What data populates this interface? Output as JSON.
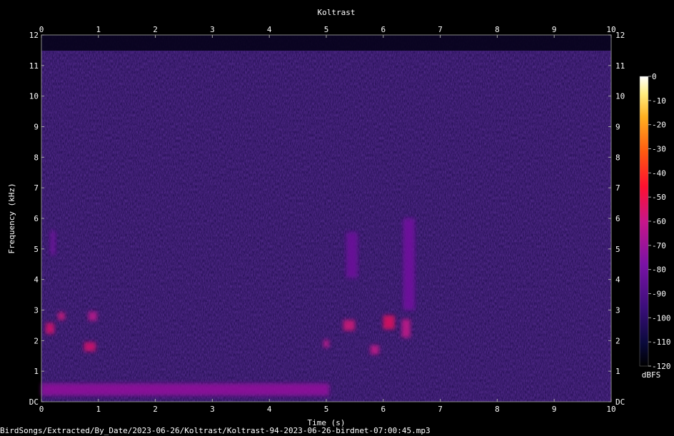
{
  "chart_data": {
    "type": "heatmap",
    "title": "Koltrast",
    "xlabel": "Time (s)",
    "ylabel": "Frequency (kHz)",
    "xlim": [
      0,
      10
    ],
    "ylim": [
      0,
      12
    ],
    "x_ticks": [
      "0",
      "1",
      "2",
      "3",
      "4",
      "5",
      "6",
      "7",
      "8",
      "9",
      "10"
    ],
    "y_ticks": [
      "DC",
      "1",
      "2",
      "3",
      "4",
      "5",
      "6",
      "7",
      "8",
      "9",
      "10",
      "11",
      "12"
    ],
    "colorbar": {
      "label": "dBFS",
      "range": [
        -120,
        0
      ],
      "ticks": [
        "0",
        "-10",
        "-20",
        "-30",
        "-40",
        "-50",
        "-60",
        "-70",
        "-80",
        "-90",
        "-100",
        "-110",
        "-120"
      ]
    },
    "background_level_dbfs": -95,
    "hotspots": [
      {
        "t": 0.15,
        "f": 2.4,
        "dt": 0.15,
        "df": 0.35,
        "db": -55
      },
      {
        "t": 0.35,
        "f": 2.8,
        "dt": 0.12,
        "df": 0.25,
        "db": -58
      },
      {
        "t": 0.85,
        "f": 1.8,
        "dt": 0.2,
        "df": 0.3,
        "db": -55
      },
      {
        "t": 0.9,
        "f": 2.8,
        "dt": 0.15,
        "df": 0.3,
        "db": -62
      },
      {
        "t": 0.2,
        "f": 5.2,
        "dt": 0.08,
        "df": 0.8,
        "db": -80
      },
      {
        "t": 5.0,
        "f": 1.9,
        "dt": 0.1,
        "df": 0.25,
        "db": -62
      },
      {
        "t": 5.4,
        "f": 2.5,
        "dt": 0.2,
        "df": 0.35,
        "db": -57
      },
      {
        "t": 5.85,
        "f": 1.7,
        "dt": 0.15,
        "df": 0.3,
        "db": -60
      },
      {
        "t": 6.1,
        "f": 2.6,
        "dt": 0.2,
        "df": 0.45,
        "db": -53
      },
      {
        "t": 6.4,
        "f": 2.4,
        "dt": 0.15,
        "df": 0.6,
        "db": -60
      },
      {
        "t": 6.45,
        "f": 4.5,
        "dt": 0.2,
        "df": 3.0,
        "db": -80
      },
      {
        "t": 5.45,
        "f": 4.8,
        "dt": 0.2,
        "df": 1.5,
        "db": -82
      },
      {
        "t": 0.05,
        "f": 0.4,
        "dt": 10.0,
        "df": 0.4,
        "db": -72
      }
    ],
    "footer": "BirdSongs/Extracted/By_Date/2023-06-26/Koltrast/Koltrast-94-2023-06-26-birdnet-07:00:45.mp3"
  }
}
